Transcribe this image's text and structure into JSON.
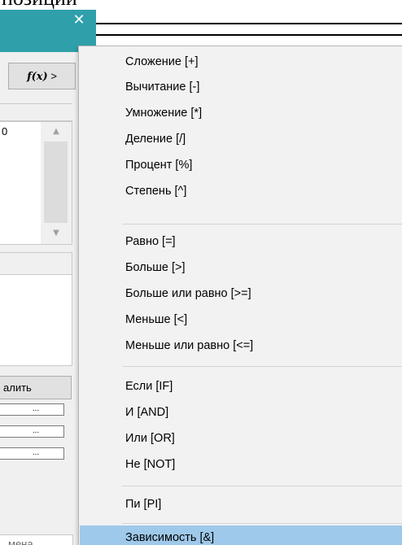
{
  "heading_fragment": "позиции",
  "dialog": {
    "close_symbol": "✕",
    "fx_button": {
      "fx": "f(x)",
      "arrow": ">"
    },
    "list_value": "0",
    "scroll_up": "▲",
    "scroll_down": "▼",
    "delete_label": "алить",
    "dots_label": "...",
    "cancel_label": "мена"
  },
  "menu": {
    "groups": [
      [
        "Сложение [+]",
        "Вычитание [-]",
        "Умножение [*]",
        "Деление [/]",
        "Процент [%]",
        "Степень [^]"
      ],
      [
        "Равно [=]",
        "Больше [>]",
        "Больше или равно [>=]",
        "Меньше [<]",
        "Меньше или равно [<=]"
      ],
      [
        "Если [IF]",
        "И [AND]",
        "Или [OR]",
        "Не [NOT]"
      ],
      [
        "Пи [PI]"
      ],
      [
        "Зависимость [&]"
      ]
    ],
    "highlighted_item": "Зависимость [&]",
    "highlight_color": "#9fc9ea"
  },
  "colors": {
    "titlebar": "#2fa0aa",
    "menu_background": "#f2f2f2",
    "dialog_background": "#f0f0f0"
  }
}
